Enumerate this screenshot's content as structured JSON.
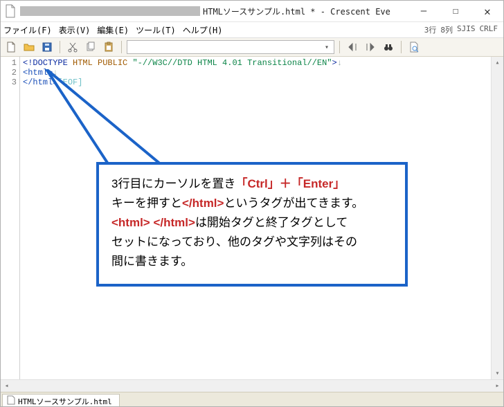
{
  "titlebar": {
    "title_suffix": "HTMLソースサンプル.html * - Crescent Eve"
  },
  "window_controls": {
    "minimize": "—",
    "maximize": "☐",
    "close": "✕"
  },
  "menu": {
    "file": "ファイル(F)",
    "view": "表示(V)",
    "edit": "編集(E)",
    "tool": "ツール(T)",
    "help": "ヘルプ(H)"
  },
  "status": {
    "line": "3行",
    "col": "8列",
    "enc": "SJIS",
    "eol": "CRLF"
  },
  "toolbar": {
    "combo_value": ""
  },
  "gutter": {
    "l1": "1",
    "l2": "2",
    "l3": "3"
  },
  "code": {
    "l1": {
      "decl_open": "<!DOCTYPE ",
      "kw": "HTML PUBLIC ",
      "str": "\"-//W3C//DTD HTML 4.01 Transitional//EN\"",
      "decl_close": ">",
      "crlf": "↓"
    },
    "l2": {
      "tag": "<html>",
      "crlf": "↓"
    },
    "l3": {
      "tag": "</html>",
      "eof": "[EOF]"
    }
  },
  "callout": {
    "p1_a": "3行目にカーソルを置き",
    "p1_b": "「Ctrl」＋「Enter」",
    "p2_a": "キーを押すと",
    "p2_b": "</html>",
    "p2_c": "というタグが出てきます。",
    "p3_a": "<html> </html>",
    "p3_b": "は開始タグと終了タグとして",
    "p4": "セットになっており、他のタグや文字列はその",
    "p5": "間に書きます。"
  },
  "tab": {
    "label": "HTMLソースサンプル.html"
  }
}
